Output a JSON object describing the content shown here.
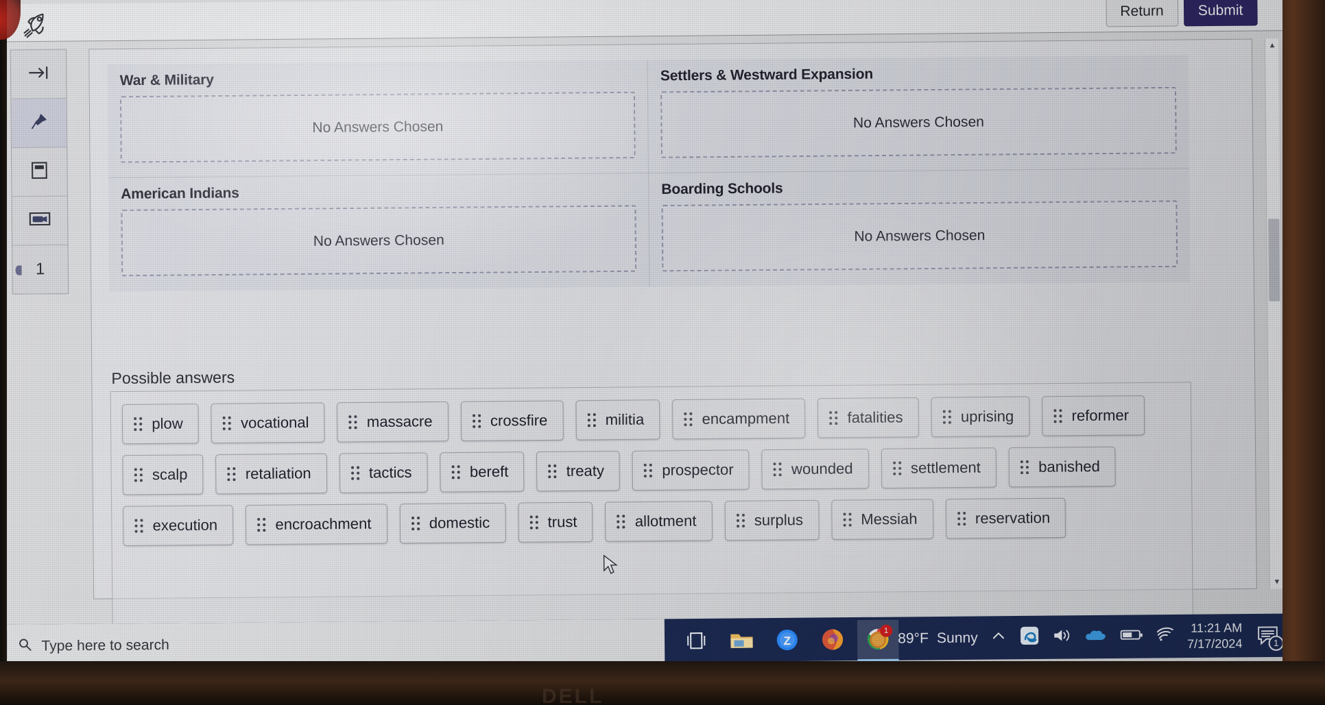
{
  "app": {
    "logo_icon": "rocket-icon",
    "return_label": "Return",
    "submit_label": "Submit",
    "accent_submit_color": "#2e2764",
    "chrome_bg_color": "#e4e5e7"
  },
  "sidebar": {
    "items": [
      {
        "icon": "arrow-to-line-icon",
        "label": ""
      },
      {
        "icon": "pin-icon",
        "label": ""
      },
      {
        "icon": "flashcard-icon",
        "label": ""
      },
      {
        "icon": "media-icon",
        "label": ""
      },
      {
        "icon": "",
        "label": "1"
      }
    ]
  },
  "question": {
    "buckets": [
      {
        "title": "War & Military",
        "placeholder": "No Answers Chosen"
      },
      {
        "title": "Settlers & Westward Expansion",
        "placeholder": "No Answers Chosen"
      },
      {
        "title": "American Indians",
        "placeholder": "No Answers Chosen"
      },
      {
        "title": "Boarding Schools",
        "placeholder": "No Answers Chosen"
      }
    ],
    "answers_label": "Possible answers",
    "answers": [
      "plow",
      "vocational",
      "massacre",
      "crossfire",
      "militia",
      "encampment",
      "fatalities",
      "uprising",
      "reformer",
      "scalp",
      "retaliation",
      "tactics",
      "bereft",
      "treaty",
      "prospector",
      "wounded",
      "settlement",
      "banished",
      "execution",
      "encroachment",
      "domestic",
      "trust",
      "allotment",
      "surplus",
      "Messiah",
      "reservation"
    ],
    "chip_handle_icon": "drag-handle-icon"
  },
  "scrollbar": {
    "up_glyph": "▲",
    "down_glyph": "▼"
  },
  "taskbar": {
    "search_placeholder": "Type here to search",
    "search_icon": "search-icon",
    "pinned": [
      {
        "icon": "task-view-icon",
        "label": "Task View"
      },
      {
        "icon": "file-explorer-icon",
        "label": "File Explorer"
      },
      {
        "icon": "zoom-icon",
        "label": "Zoom"
      },
      {
        "icon": "firefox-icon",
        "label": "Firefox"
      },
      {
        "icon": "chrome-icon",
        "label": "Google Chrome"
      }
    ],
    "weather": {
      "icon": "weather-sunny-icon",
      "temperature": "89°F",
      "condition": "Sunny",
      "badge": "1"
    },
    "tray": [
      {
        "icon": "chevron-up-icon"
      },
      {
        "icon": "edge-icon"
      },
      {
        "icon": "volume-icon"
      },
      {
        "icon": "onedrive-icon"
      },
      {
        "icon": "battery-icon"
      },
      {
        "icon": "wifi-icon"
      }
    ],
    "clock": {
      "time": "11:21 AM",
      "date": "7/17/2024"
    },
    "notifications": {
      "icon": "notification-icon",
      "count": "1"
    }
  },
  "device": {
    "brand": "DELL"
  }
}
